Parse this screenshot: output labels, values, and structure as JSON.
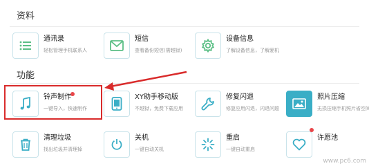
{
  "sections": {
    "data_title": "资料",
    "features_title": "功能"
  },
  "data_tiles": [
    {
      "title": "通讯录",
      "desc": "轻松管理手机联系人",
      "icon": "list-icon"
    },
    {
      "title": "短信",
      "desc": "查看备份短信(需越狱)",
      "icon": "envelope-icon"
    },
    {
      "title": "设备信息",
      "desc": "了解设备信息，了解爱机",
      "icon": "gear-icon"
    }
  ],
  "feature_tiles_row1": [
    {
      "title": "铃声制作",
      "desc": "一键导入，快速制作",
      "icon": "music-note-icon"
    },
    {
      "title": "XY助手移动版",
      "desc": "不越狱，免费下载应用",
      "icon": "tablet-icon"
    },
    {
      "title": "修复闪退",
      "desc": "修复应用闪退，闪退问题",
      "icon": "wrench-icon"
    },
    {
      "title": "照片压缩",
      "desc": "无损压缩手机照片省空间",
      "icon": "image-icon"
    }
  ],
  "feature_tiles_row2": [
    {
      "title": "清理垃圾",
      "desc": "找出垃圾并清理掉",
      "icon": "trash-icon"
    },
    {
      "title": "关机",
      "desc": "一键自动关机",
      "icon": "power-icon"
    },
    {
      "title": "重启",
      "desc": "一键自动重启",
      "icon": "spinner-icon"
    },
    {
      "title": "许愿池",
      "desc": "",
      "icon": "heart-icon"
    }
  ],
  "watermark": "www.pc6.com",
  "colors": {
    "accent": "#3aaec6",
    "icon_green": "#5cbf86",
    "highlight_red": "#d92b2b",
    "badge_red": "#e9464a"
  }
}
